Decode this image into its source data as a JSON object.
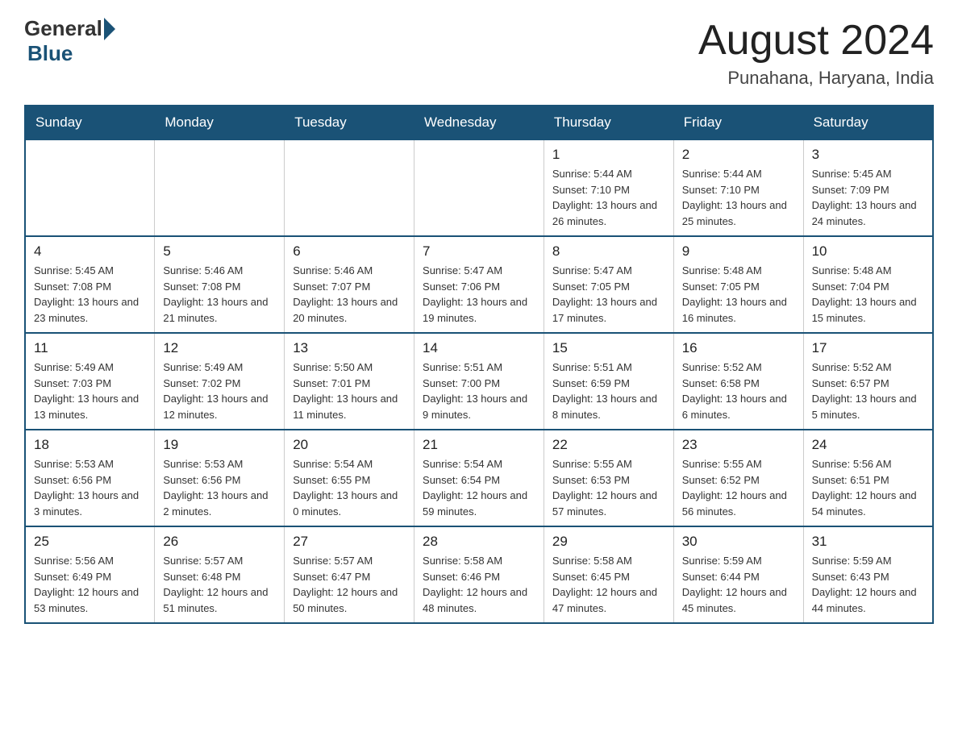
{
  "header": {
    "logo": {
      "general": "General",
      "blue": "Blue"
    },
    "title": "August 2024",
    "location": "Punahana, Haryana, India"
  },
  "days_of_week": [
    "Sunday",
    "Monday",
    "Tuesday",
    "Wednesday",
    "Thursday",
    "Friday",
    "Saturday"
  ],
  "weeks": [
    [
      {
        "day": "",
        "info": ""
      },
      {
        "day": "",
        "info": ""
      },
      {
        "day": "",
        "info": ""
      },
      {
        "day": "",
        "info": ""
      },
      {
        "day": "1",
        "info": "Sunrise: 5:44 AM\nSunset: 7:10 PM\nDaylight: 13 hours and 26 minutes."
      },
      {
        "day": "2",
        "info": "Sunrise: 5:44 AM\nSunset: 7:10 PM\nDaylight: 13 hours and 25 minutes."
      },
      {
        "day": "3",
        "info": "Sunrise: 5:45 AM\nSunset: 7:09 PM\nDaylight: 13 hours and 24 minutes."
      }
    ],
    [
      {
        "day": "4",
        "info": "Sunrise: 5:45 AM\nSunset: 7:08 PM\nDaylight: 13 hours and 23 minutes."
      },
      {
        "day": "5",
        "info": "Sunrise: 5:46 AM\nSunset: 7:08 PM\nDaylight: 13 hours and 21 minutes."
      },
      {
        "day": "6",
        "info": "Sunrise: 5:46 AM\nSunset: 7:07 PM\nDaylight: 13 hours and 20 minutes."
      },
      {
        "day": "7",
        "info": "Sunrise: 5:47 AM\nSunset: 7:06 PM\nDaylight: 13 hours and 19 minutes."
      },
      {
        "day": "8",
        "info": "Sunrise: 5:47 AM\nSunset: 7:05 PM\nDaylight: 13 hours and 17 minutes."
      },
      {
        "day": "9",
        "info": "Sunrise: 5:48 AM\nSunset: 7:05 PM\nDaylight: 13 hours and 16 minutes."
      },
      {
        "day": "10",
        "info": "Sunrise: 5:48 AM\nSunset: 7:04 PM\nDaylight: 13 hours and 15 minutes."
      }
    ],
    [
      {
        "day": "11",
        "info": "Sunrise: 5:49 AM\nSunset: 7:03 PM\nDaylight: 13 hours and 13 minutes."
      },
      {
        "day": "12",
        "info": "Sunrise: 5:49 AM\nSunset: 7:02 PM\nDaylight: 13 hours and 12 minutes."
      },
      {
        "day": "13",
        "info": "Sunrise: 5:50 AM\nSunset: 7:01 PM\nDaylight: 13 hours and 11 minutes."
      },
      {
        "day": "14",
        "info": "Sunrise: 5:51 AM\nSunset: 7:00 PM\nDaylight: 13 hours and 9 minutes."
      },
      {
        "day": "15",
        "info": "Sunrise: 5:51 AM\nSunset: 6:59 PM\nDaylight: 13 hours and 8 minutes."
      },
      {
        "day": "16",
        "info": "Sunrise: 5:52 AM\nSunset: 6:58 PM\nDaylight: 13 hours and 6 minutes."
      },
      {
        "day": "17",
        "info": "Sunrise: 5:52 AM\nSunset: 6:57 PM\nDaylight: 13 hours and 5 minutes."
      }
    ],
    [
      {
        "day": "18",
        "info": "Sunrise: 5:53 AM\nSunset: 6:56 PM\nDaylight: 13 hours and 3 minutes."
      },
      {
        "day": "19",
        "info": "Sunrise: 5:53 AM\nSunset: 6:56 PM\nDaylight: 13 hours and 2 minutes."
      },
      {
        "day": "20",
        "info": "Sunrise: 5:54 AM\nSunset: 6:55 PM\nDaylight: 13 hours and 0 minutes."
      },
      {
        "day": "21",
        "info": "Sunrise: 5:54 AM\nSunset: 6:54 PM\nDaylight: 12 hours and 59 minutes."
      },
      {
        "day": "22",
        "info": "Sunrise: 5:55 AM\nSunset: 6:53 PM\nDaylight: 12 hours and 57 minutes."
      },
      {
        "day": "23",
        "info": "Sunrise: 5:55 AM\nSunset: 6:52 PM\nDaylight: 12 hours and 56 minutes."
      },
      {
        "day": "24",
        "info": "Sunrise: 5:56 AM\nSunset: 6:51 PM\nDaylight: 12 hours and 54 minutes."
      }
    ],
    [
      {
        "day": "25",
        "info": "Sunrise: 5:56 AM\nSunset: 6:49 PM\nDaylight: 12 hours and 53 minutes."
      },
      {
        "day": "26",
        "info": "Sunrise: 5:57 AM\nSunset: 6:48 PM\nDaylight: 12 hours and 51 minutes."
      },
      {
        "day": "27",
        "info": "Sunrise: 5:57 AM\nSunset: 6:47 PM\nDaylight: 12 hours and 50 minutes."
      },
      {
        "day": "28",
        "info": "Sunrise: 5:58 AM\nSunset: 6:46 PM\nDaylight: 12 hours and 48 minutes."
      },
      {
        "day": "29",
        "info": "Sunrise: 5:58 AM\nSunset: 6:45 PM\nDaylight: 12 hours and 47 minutes."
      },
      {
        "day": "30",
        "info": "Sunrise: 5:59 AM\nSunset: 6:44 PM\nDaylight: 12 hours and 45 minutes."
      },
      {
        "day": "31",
        "info": "Sunrise: 5:59 AM\nSunset: 6:43 PM\nDaylight: 12 hours and 44 minutes."
      }
    ]
  ]
}
